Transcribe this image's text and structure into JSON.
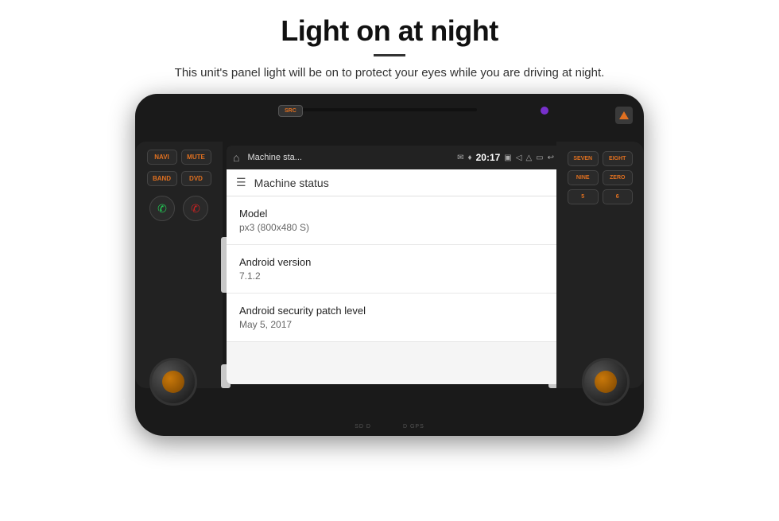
{
  "page": {
    "title": "Light on at night",
    "divider": true,
    "subtitle": "This unit's panel light will be on to protect your eyes while you are driving at night."
  },
  "unit": {
    "src_button": "SRC",
    "left_buttons": {
      "row1": [
        "NAVI",
        "MUTE"
      ],
      "row2": [
        "BAND",
        "DVD"
      ]
    },
    "right_buttons": {
      "grid": [
        "SEVEN",
        "EIGHT",
        "NINE",
        "ZERO",
        "5",
        "6"
      ]
    }
  },
  "android": {
    "status_bar": {
      "title": "Machine sta...",
      "time": "20:17"
    },
    "topbar_title": "Machine status",
    "items": [
      {
        "label": "Model",
        "value": "px3 (800x480 S)"
      },
      {
        "label": "Android version",
        "value": "7.1.2"
      },
      {
        "label": "Android security patch level",
        "value": "May 5, 2017"
      }
    ]
  },
  "bottom_strip": {
    "left": "SD  D",
    "right": "D  GPS"
  }
}
